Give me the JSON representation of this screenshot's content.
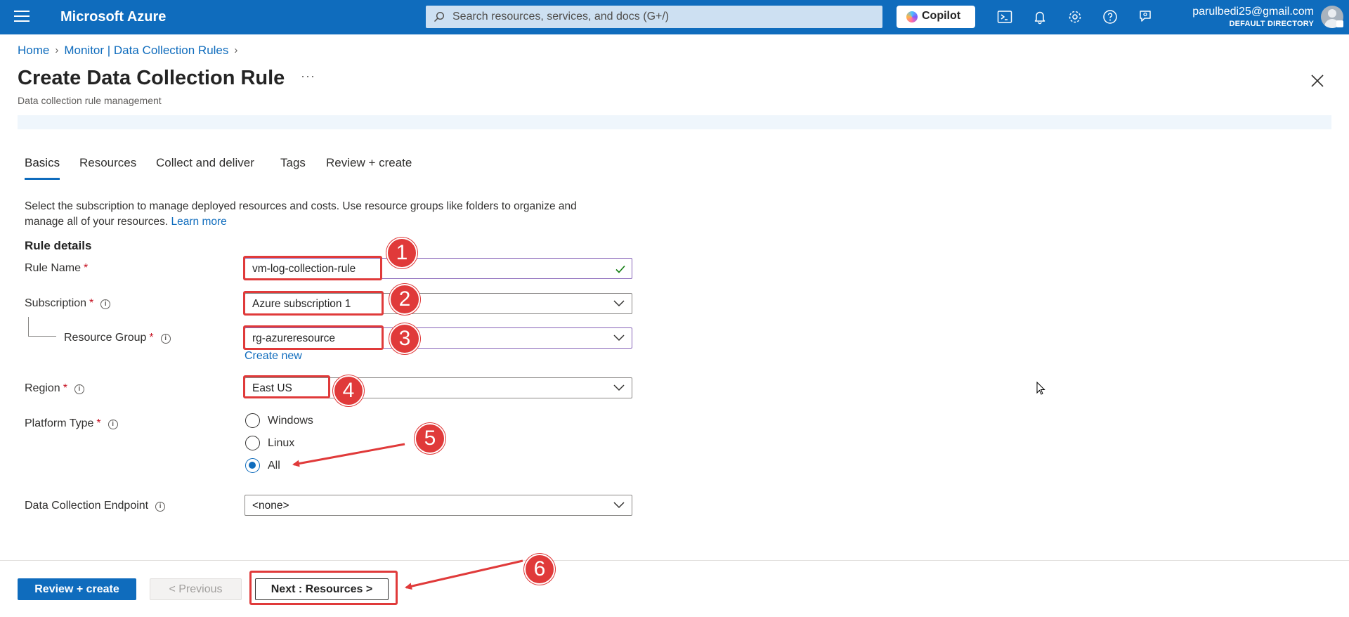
{
  "topbar": {
    "brand": "Microsoft Azure",
    "search_placeholder": "Search resources, services, and docs (G+/)",
    "copilot_label": "Copilot",
    "user_email": "parulbedi25@gmail.com",
    "user_directory": "DEFAULT DIRECTORY",
    "icons": [
      "menu-icon",
      "cloud-shell-icon",
      "bell-icon",
      "gear-icon",
      "help-icon",
      "feedback-icon"
    ]
  },
  "breadcrumb": {
    "items": [
      "Home",
      "Monitor | Data Collection Rules"
    ]
  },
  "page": {
    "title": "Create Data Collection Rule",
    "more": "···",
    "subtitle": "Data collection rule management"
  },
  "tabs": [
    "Basics",
    "Resources",
    "Collect and deliver",
    "Tags",
    "Review + create"
  ],
  "active_tab": "Basics",
  "intro": {
    "text": "Select the subscription to manage deployed resources and costs. Use resource groups like folders to organize and manage all of your resources.",
    "link": "Learn more"
  },
  "form": {
    "section_title": "Rule details",
    "rule_name": {
      "label": "Rule Name",
      "value": "vm-log-collection-rule"
    },
    "subscription": {
      "label": "Subscription",
      "value": "Azure subscription 1"
    },
    "resource_group": {
      "label": "Resource Group",
      "value": "rg-azureresource",
      "create_new": "Create new"
    },
    "region": {
      "label": "Region",
      "value": "East US"
    },
    "platform_type": {
      "label": "Platform Type",
      "options": [
        "Windows",
        "Linux",
        "All"
      ],
      "selected": "All"
    },
    "endpoint": {
      "label": "Data Collection Endpoint",
      "value": "<none>"
    },
    "required_mark": "*"
  },
  "annotations": {
    "badges": [
      "1",
      "2",
      "3",
      "4",
      "5",
      "6"
    ],
    "color": "#e03a3a"
  },
  "footer": {
    "review_create": "Review + create",
    "previous": "< Previous",
    "next": "Next : Resources >"
  },
  "colors": {
    "accent": "#0f6cbd",
    "topbar": "#0f6cbd",
    "required": "#c50f1f"
  }
}
